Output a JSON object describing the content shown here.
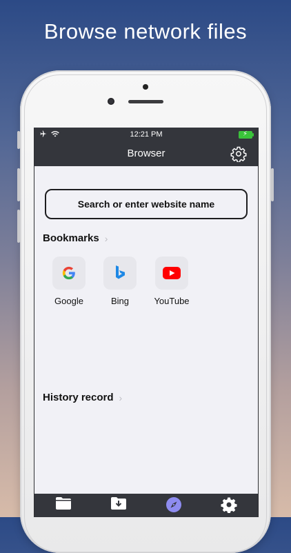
{
  "promo": {
    "headline": "Browse network files"
  },
  "status_bar": {
    "time": "12:21 PM",
    "battery_charging": true
  },
  "nav": {
    "title": "Browser",
    "settings_icon": "gear-icon"
  },
  "search": {
    "placeholder": "Search or enter website name"
  },
  "bookmarks": {
    "title": "Bookmarks",
    "items": [
      {
        "label": "Google",
        "icon": "google-icon"
      },
      {
        "label": "Bing",
        "icon": "bing-icon"
      },
      {
        "label": "YouTube",
        "icon": "youtube-icon"
      }
    ]
  },
  "history": {
    "title": "History record"
  },
  "tabbar": {
    "active_index": 2,
    "active_color": "#8e8cf0",
    "items": [
      {
        "icon": "folder-icon"
      },
      {
        "icon": "download-folder-icon"
      },
      {
        "icon": "compass-icon"
      },
      {
        "icon": "gear-icon"
      }
    ]
  },
  "colors": {
    "bar_bg": "#34363c",
    "screen_bg": "#f1f1f6",
    "youtube_red": "#ff0000",
    "bing_blue": "#1e88e5"
  }
}
